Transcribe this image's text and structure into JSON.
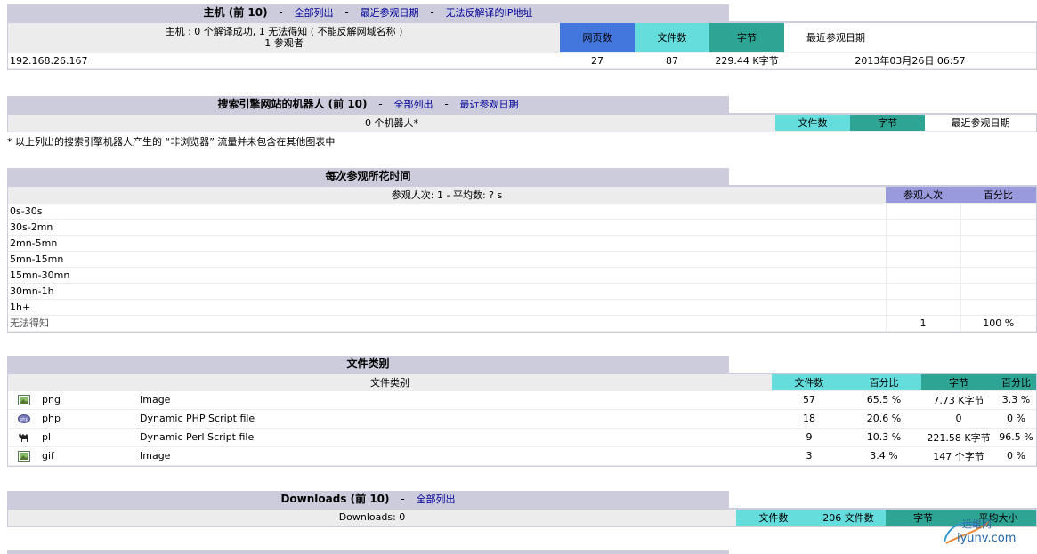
{
  "hosts": {
    "title": "主机 (前 10)",
    "links": [
      "全部列出",
      "最近参观日期",
      "无法反解译的IP地址"
    ],
    "summary_line1": "主机 : 0 个解译成功, 1 无法得知 ( 不能反解网域名称 )",
    "summary_line2": "1 参观者",
    "headers": [
      "网页数",
      "文件数",
      "字节",
      "最近参观日期"
    ],
    "rows": [
      {
        "host": "192.168.26.167",
        "pages": "27",
        "files": "87",
        "bytes": "229.44 K字节",
        "last": "2013年03月26日  06:57"
      }
    ]
  },
  "robots": {
    "title": "搜索引擎网站的机器人 (前 10)",
    "links": [
      "全部列出",
      "最近参观日期"
    ],
    "summary": "0 个机器人*",
    "headers": [
      "文件数",
      "字节",
      "最近参观日期"
    ],
    "note": "* 以上列出的搜索引擎机器人产生的 “非浏览器” 流量并未包含在其他图表中"
  },
  "duration": {
    "title": "每次参观所花时间",
    "summary": "参观人次: 1 - 平均数: ? s",
    "headers": [
      "参观人次",
      "百分比"
    ],
    "rows": [
      {
        "label": "0s-30s",
        "visits": "",
        "pct": ""
      },
      {
        "label": "30s-2mn",
        "visits": "",
        "pct": ""
      },
      {
        "label": "2mn-5mn",
        "visits": "",
        "pct": ""
      },
      {
        "label": "5mn-15mn",
        "visits": "",
        "pct": ""
      },
      {
        "label": "15mn-30mn",
        "visits": "",
        "pct": ""
      },
      {
        "label": "30mn-1h",
        "visits": "",
        "pct": ""
      },
      {
        "label": "1h+",
        "visits": "",
        "pct": ""
      },
      {
        "label": "无法得知",
        "visits": "1",
        "pct": "100 %"
      }
    ]
  },
  "filetypes": {
    "title": "文件类别",
    "header_label": "文件类别",
    "headers": [
      "文件数",
      "百分比",
      "字节",
      "百分比"
    ],
    "rows": [
      {
        "icon": "image-icon",
        "ext": "png",
        "desc": "Image",
        "files": "57",
        "pct": "65.5 %",
        "bytes": "7.73 K字节",
        "bpct": "3.3 %"
      },
      {
        "icon": "php-icon",
        "ext": "php",
        "desc": "Dynamic PHP Script file",
        "files": "18",
        "pct": "20.6 %",
        "bytes": "0",
        "bpct": "0 %"
      },
      {
        "icon": "camel-icon",
        "ext": "pl",
        "desc": "Dynamic Perl Script file",
        "files": "9",
        "pct": "10.3 %",
        "bytes": "221.58 K字节",
        "bpct": "96.5 %"
      },
      {
        "icon": "image-icon",
        "ext": "gif",
        "desc": "Image",
        "files": "3",
        "pct": "3.4 %",
        "bytes": "147 个字节",
        "bpct": "0 %"
      }
    ]
  },
  "downloads": {
    "title": "Downloads (前 10)",
    "links": [
      "全部列出"
    ],
    "summary": "Downloads: 0",
    "headers": [
      "文件数",
      "206 文件数",
      "字节",
      "平均大小"
    ]
  },
  "watermark": {
    "line1": "运维网",
    "line2": "iyunv.com"
  },
  "colors": {
    "title_bg": "#ccccdd",
    "pages": "#4477dd",
    "files": "#66dddd",
    "bytes": "#2ea495",
    "visits": "#9999dd",
    "link": "#000099"
  }
}
